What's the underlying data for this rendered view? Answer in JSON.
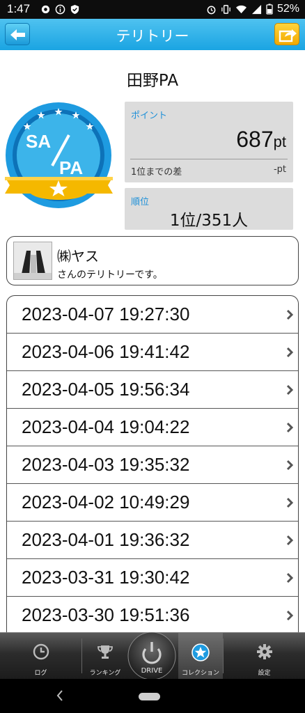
{
  "status_bar": {
    "time": "1:47",
    "battery": "52%"
  },
  "header": {
    "title": "テリトリー"
  },
  "area": {
    "name": "田野PA",
    "badge_top": "SA",
    "badge_bottom": "PA"
  },
  "points": {
    "label": "ポイント",
    "value": "687",
    "unit": "pt",
    "diff_label": "1位までの差",
    "diff_value": "-pt"
  },
  "rank": {
    "label": "順位",
    "value": "1位/351人"
  },
  "owner": {
    "name": "㈱ヤス",
    "note": "さんのテリトリーです。"
  },
  "history": [
    "2023-04-07 19:27:30",
    "2023-04-06 19:41:42",
    "2023-04-05 19:56:34",
    "2023-04-04 19:04:22",
    "2023-04-03 19:35:32",
    "2023-04-02 10:49:29",
    "2023-04-01 19:36:32",
    "2023-03-31 19:30:42",
    "2023-03-30 19:51:36"
  ],
  "tabs": [
    {
      "label": "ログ",
      "icon": "clock-icon"
    },
    {
      "label": "ランキング",
      "icon": "trophy-icon"
    },
    {
      "label": "DRIVE",
      "icon": "power-icon"
    },
    {
      "label": "コレクション",
      "icon": "star-icon",
      "active": true
    },
    {
      "label": "設定",
      "icon": "gear-icon"
    }
  ],
  "colors": {
    "header": "#1aa4e2",
    "accent_label": "#1e90d8",
    "badge_ring": "#1e9be0",
    "badge_ribbon": "#f5b800"
  }
}
